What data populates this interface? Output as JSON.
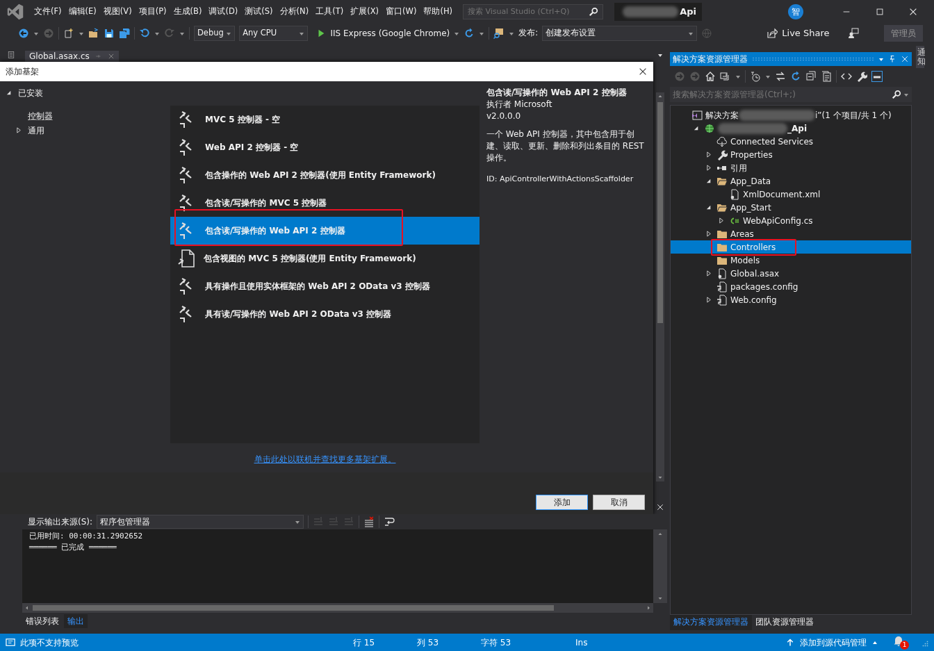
{
  "window": {
    "title": "Api",
    "title_redacted": true,
    "menu": [
      "文件(F)",
      "编辑(E)",
      "视图(V)",
      "项目(P)",
      "生成(B)",
      "调试(D)",
      "测试(S)",
      "分析(N)",
      "工具(T)",
      "扩展(X)",
      "窗口(W)",
      "帮助(H)"
    ],
    "search": {
      "placeholder": "搜索 Visual Studio (Ctrl+Q)"
    },
    "avatar": "智",
    "account_button": "管理员"
  },
  "toolbar": {
    "configuration": "Debug",
    "platform": "Any CPU",
    "run_target": "IIS Express (Google Chrome)",
    "publish_label": "发布:",
    "publish_profile": "创建发布设置",
    "live_share": "Live Share"
  },
  "editor_tabs": [
    {
      "label": "Global.asax.cs",
      "selected": true
    }
  ],
  "dialog": {
    "title": "添加基架",
    "tree": [
      {
        "label": "已安装",
        "expanded": true,
        "selected": false,
        "children": [
          {
            "label": "控制器",
            "selected": true
          },
          {
            "label": "通用",
            "expanded": false,
            "selected": false
          }
        ]
      }
    ],
    "templates": [
      {
        "label": "MVC 5 控制器 - 空",
        "kind": "controller",
        "selected": false,
        "highlighted": false
      },
      {
        "label": "Web API 2 控制器 - 空",
        "kind": "controller",
        "selected": false,
        "highlighted": false
      },
      {
        "label": "包含操作的 Web API 2 控制器(使用 Entity Framework)",
        "kind": "controller",
        "selected": false,
        "highlighted": false
      },
      {
        "label": "包含读/写操作的 MVC 5 控制器",
        "kind": "controller",
        "selected": false,
        "highlighted": false
      },
      {
        "label": "包含读/写操作的 Web API 2 控制器",
        "kind": "controller",
        "selected": true,
        "highlighted": true
      },
      {
        "label": "包含视图的 MVC 5 控制器(使用 Entity Framework)",
        "kind": "view",
        "selected": false,
        "highlighted": false
      },
      {
        "label": "具有操作且使用实体框架的 Web API 2 OData v3 控制器",
        "kind": "controller",
        "selected": false,
        "highlighted": false
      },
      {
        "label": "具有读/写操作的 Web API 2 OData v3 控制器",
        "kind": "controller",
        "selected": false,
        "highlighted": false
      }
    ],
    "details": {
      "title": "包含读/写操作的 Web API 2 控制器",
      "author": "执行者 Microsoft",
      "version": "v2.0.0.0",
      "description": "一个 Web API 控制器，其中包含用于创建、读取、更新、删除和列出条目的 REST 操作。",
      "id": "ID: ApiControllerWithActionsScaffolder"
    },
    "online_link": "单击此处以联机并查找更多基架扩展。",
    "buttons": [
      "添加",
      "取消"
    ]
  },
  "output": {
    "source_label": "显示输出来源(S):",
    "source": "程序包管理器",
    "lines": [
      "已用时间: 00:00:31.2902652",
      "══════ 已完成 ══════"
    ],
    "tabs": [
      {
        "label": "错误列表",
        "selected": false
      },
      {
        "label": "输出",
        "selected": true
      }
    ]
  },
  "solution_explorer": {
    "title": "解决方案资源管理器",
    "search": {
      "placeholder": "搜索解决方案资源管理器(Ctrl+;)"
    },
    "tree": [
      {
        "label": "解决方案",
        "label_after": "i”(1 个项目/共 1 个)",
        "redacted": true,
        "kind": "solution",
        "selected": false,
        "children": [
          {
            "label": "_Api",
            "redacted": true,
            "kind": "project",
            "expanded": true,
            "selected": false,
            "children": [
              {
                "label": "Connected Services",
                "kind": "service",
                "selected": false
              },
              {
                "label": "Properties",
                "kind": "wrench",
                "expanded": false,
                "selected": false
              },
              {
                "label": "引用",
                "kind": "reference",
                "expanded": false,
                "selected": false
              },
              {
                "label": "App_Data",
                "kind": "folder",
                "expanded": true,
                "selected": false,
                "children": [
                  {
                    "label": "XmlDocument.xml",
                    "kind": "file",
                    "selected": false
                  }
                ]
              },
              {
                "label": "App_Start",
                "kind": "folder",
                "expanded": true,
                "selected": false,
                "children": [
                  {
                    "label": "WebApiConfig.cs",
                    "kind": "csharp",
                    "expanded": false,
                    "selected": false
                  }
                ]
              },
              {
                "label": "Areas",
                "kind": "folder",
                "expanded": false,
                "selected": false
              },
              {
                "label": "Controllers",
                "kind": "folder",
                "selected": true,
                "highlighted": true
              },
              {
                "label": "Models",
                "kind": "folder",
                "selected": false
              },
              {
                "label": "Global.asax",
                "kind": "file",
                "expanded": false,
                "selected": false
              },
              {
                "label": "packages.config",
                "kind": "config",
                "selected": false
              },
              {
                "label": "Web.config",
                "kind": "config",
                "expanded": false,
                "selected": false
              }
            ]
          }
        ]
      }
    ],
    "tabs": [
      {
        "label": "解决方案资源管理器",
        "selected": true
      },
      {
        "label": "团队资源管理器",
        "selected": false
      }
    ]
  },
  "side_tab": "通知",
  "status_bar": {
    "message": "此项不支持预览",
    "line": "行 15",
    "column": "列 53",
    "char": "字符 53",
    "mode": "Ins",
    "source_control": "添加到源代码管理",
    "notification_count": "1"
  }
}
